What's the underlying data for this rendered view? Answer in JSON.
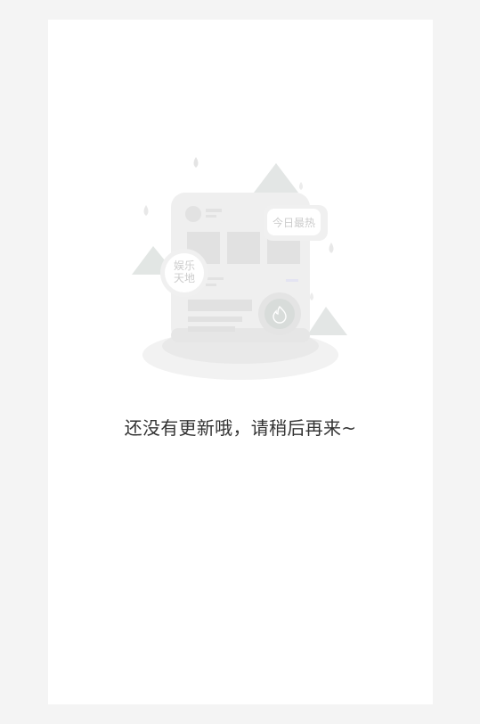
{
  "empty_state": {
    "badge_today_hot": "今日最热",
    "badge_entertainment_line1": "娱乐",
    "badge_entertainment_line2": "天地",
    "message": "还没有更新哦，请稍后再来~",
    "illustration_icon": "flame-icon"
  }
}
